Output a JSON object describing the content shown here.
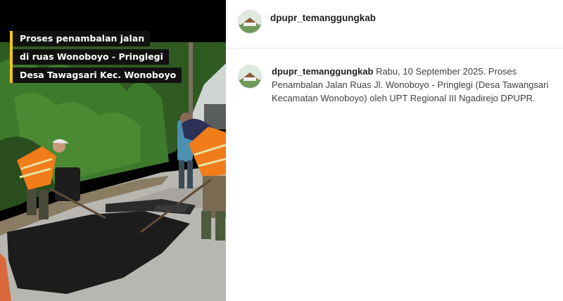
{
  "media": {
    "overlay_lines": [
      "Proses penambalan jalan",
      "di ruas Wonoboyo - Pringlegi",
      "Desa Tawagsari Kec. Wonoboyo"
    ],
    "accent_color": "#f5c518"
  },
  "header": {
    "username": "dpupr_temanggungkab",
    "avatar_icon": "building-logo-icon"
  },
  "comment": {
    "author": "dpupr_temanggungkab",
    "text": " Rabu, 10 September 2025. Proses Penambalan Jalan Ruas Jl. Wonoboyo - Pringlegi (Desa Tawangsari Kecamatan Wonoboyo) oleh UPT Regional III Ngadirejo DPUPR."
  }
}
